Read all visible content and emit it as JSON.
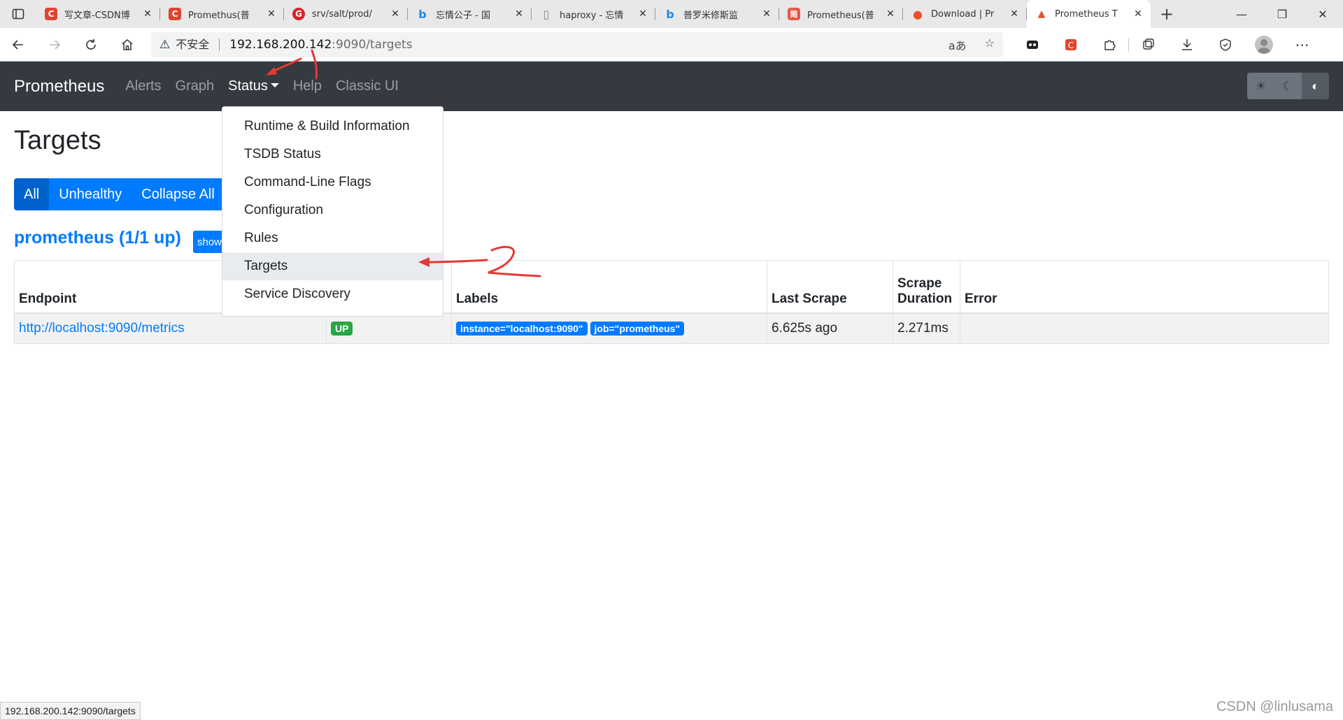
{
  "browser": {
    "tabs": [
      {
        "title": "写文章-CSDN博",
        "favicon": "C",
        "color": "#e0442f"
      },
      {
        "title": "Promethus(普",
        "favicon": "C",
        "color": "#e0442f"
      },
      {
        "title": "srv/salt/prod/",
        "favicon": "G",
        "color": "#d8232a"
      },
      {
        "title": "忘情公子 - 国",
        "favicon": "b",
        "color": "#1e88e5"
      },
      {
        "title": "haproxy - 忘情",
        "favicon": "▯",
        "color": "#8a8a8a"
      },
      {
        "title": "普罗米修斯监",
        "favicon": "b",
        "color": "#1e88e5"
      },
      {
        "title": "Prometheus(普",
        "favicon": "简",
        "color": "#e9574a"
      },
      {
        "title": "Download | Pr",
        "favicon": "●",
        "color": "#e6522c"
      },
      {
        "title": "Prometheus T",
        "favicon": "🔥",
        "color": "#ffffff"
      }
    ],
    "new_tab": "+",
    "window_controls": [
      "—",
      "❐",
      "✕"
    ],
    "address": {
      "insecure_label": "不安全",
      "host": "192.168.200.142",
      "rest": ":9090/targets"
    }
  },
  "nav": {
    "brand": "Prometheus",
    "links": [
      "Alerts",
      "Graph",
      "Status",
      "Help",
      "Classic UI"
    ],
    "theme_icons": [
      "☀",
      "☾",
      "◐"
    ]
  },
  "dropdown": {
    "items": [
      "Runtime & Build Information",
      "TSDB Status",
      "Command-Line Flags",
      "Configuration",
      "Rules",
      "Targets",
      "Service Discovery"
    ]
  },
  "page": {
    "title": "Targets",
    "filters": [
      "All",
      "Unhealthy",
      "Collapse All"
    ],
    "job_heading": "prometheus (1/1 up)",
    "show_button": "show"
  },
  "table": {
    "headers": [
      "Endpoint",
      "",
      "Labels",
      "Last Scrape",
      "Scrape Duration",
      "Error"
    ],
    "rows": [
      {
        "endpoint": "http://localhost:9090/metrics",
        "state": "UP",
        "labels": [
          "instance=\"localhost:9090\"",
          "job=\"prometheus\""
        ],
        "last_scrape": "6.625s ago",
        "scrape_duration": "2.271ms",
        "error": ""
      }
    ]
  },
  "status_bar": "192.168.200.142:9090/targets",
  "watermark": "CSDN @linlusama",
  "annotations": [
    "1",
    "2"
  ]
}
